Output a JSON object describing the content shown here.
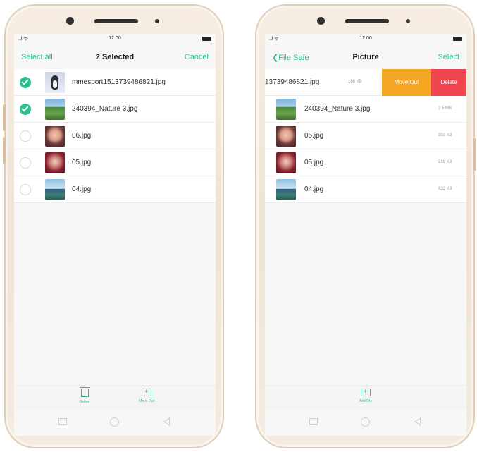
{
  "left_phone": {
    "status": {
      "time": "12:00",
      "signal": "..l ᯤ"
    },
    "header": {
      "select_all": "Select all",
      "title": "2 Selected",
      "cancel": "Cancel"
    },
    "files": [
      {
        "name": "mmesport1513739486821.jpg",
        "checked": true,
        "thumb": "penguin-image"
      },
      {
        "name": "240394_Nature 3.jpg",
        "checked": true,
        "thumb": "nature-image"
      },
      {
        "name": "06.jpg",
        "checked": false,
        "thumb": "portrait-image"
      },
      {
        "name": "05.jpg",
        "checked": false,
        "thumb": "portrait-image"
      },
      {
        "name": "04.jpg",
        "checked": false,
        "thumb": "landscape-image"
      }
    ],
    "toolbar": {
      "delete_label": "Delete",
      "move_out_label": "Move Out"
    }
  },
  "right_phone": {
    "status": {
      "time": "12:00",
      "signal": "..l ᯤ"
    },
    "header": {
      "back_label": "File Safe",
      "title": "Picture",
      "select": "Select"
    },
    "swiped_file": {
      "name": "13739486821.jpg",
      "size": "166 KB",
      "move_out": "Move Out",
      "delete": "Delete"
    },
    "files": [
      {
        "name": "240394_Nature 3.jpg",
        "size": "3.5 MB",
        "thumb": "nature-image"
      },
      {
        "name": "06.jpg",
        "size": "502 KB",
        "thumb": "portrait-image"
      },
      {
        "name": "05.jpg",
        "size": "219 KB",
        "thumb": "portrait-image"
      },
      {
        "name": "04.jpg",
        "size": "632 KB",
        "thumb": "landscape-image"
      }
    ],
    "toolbar": {
      "add_file_label": "Add File"
    }
  },
  "colors": {
    "accent": "#2bbf8f",
    "move_out": "#f5a623",
    "delete": "#f0454e",
    "phone_body": "#f3e9dd"
  }
}
